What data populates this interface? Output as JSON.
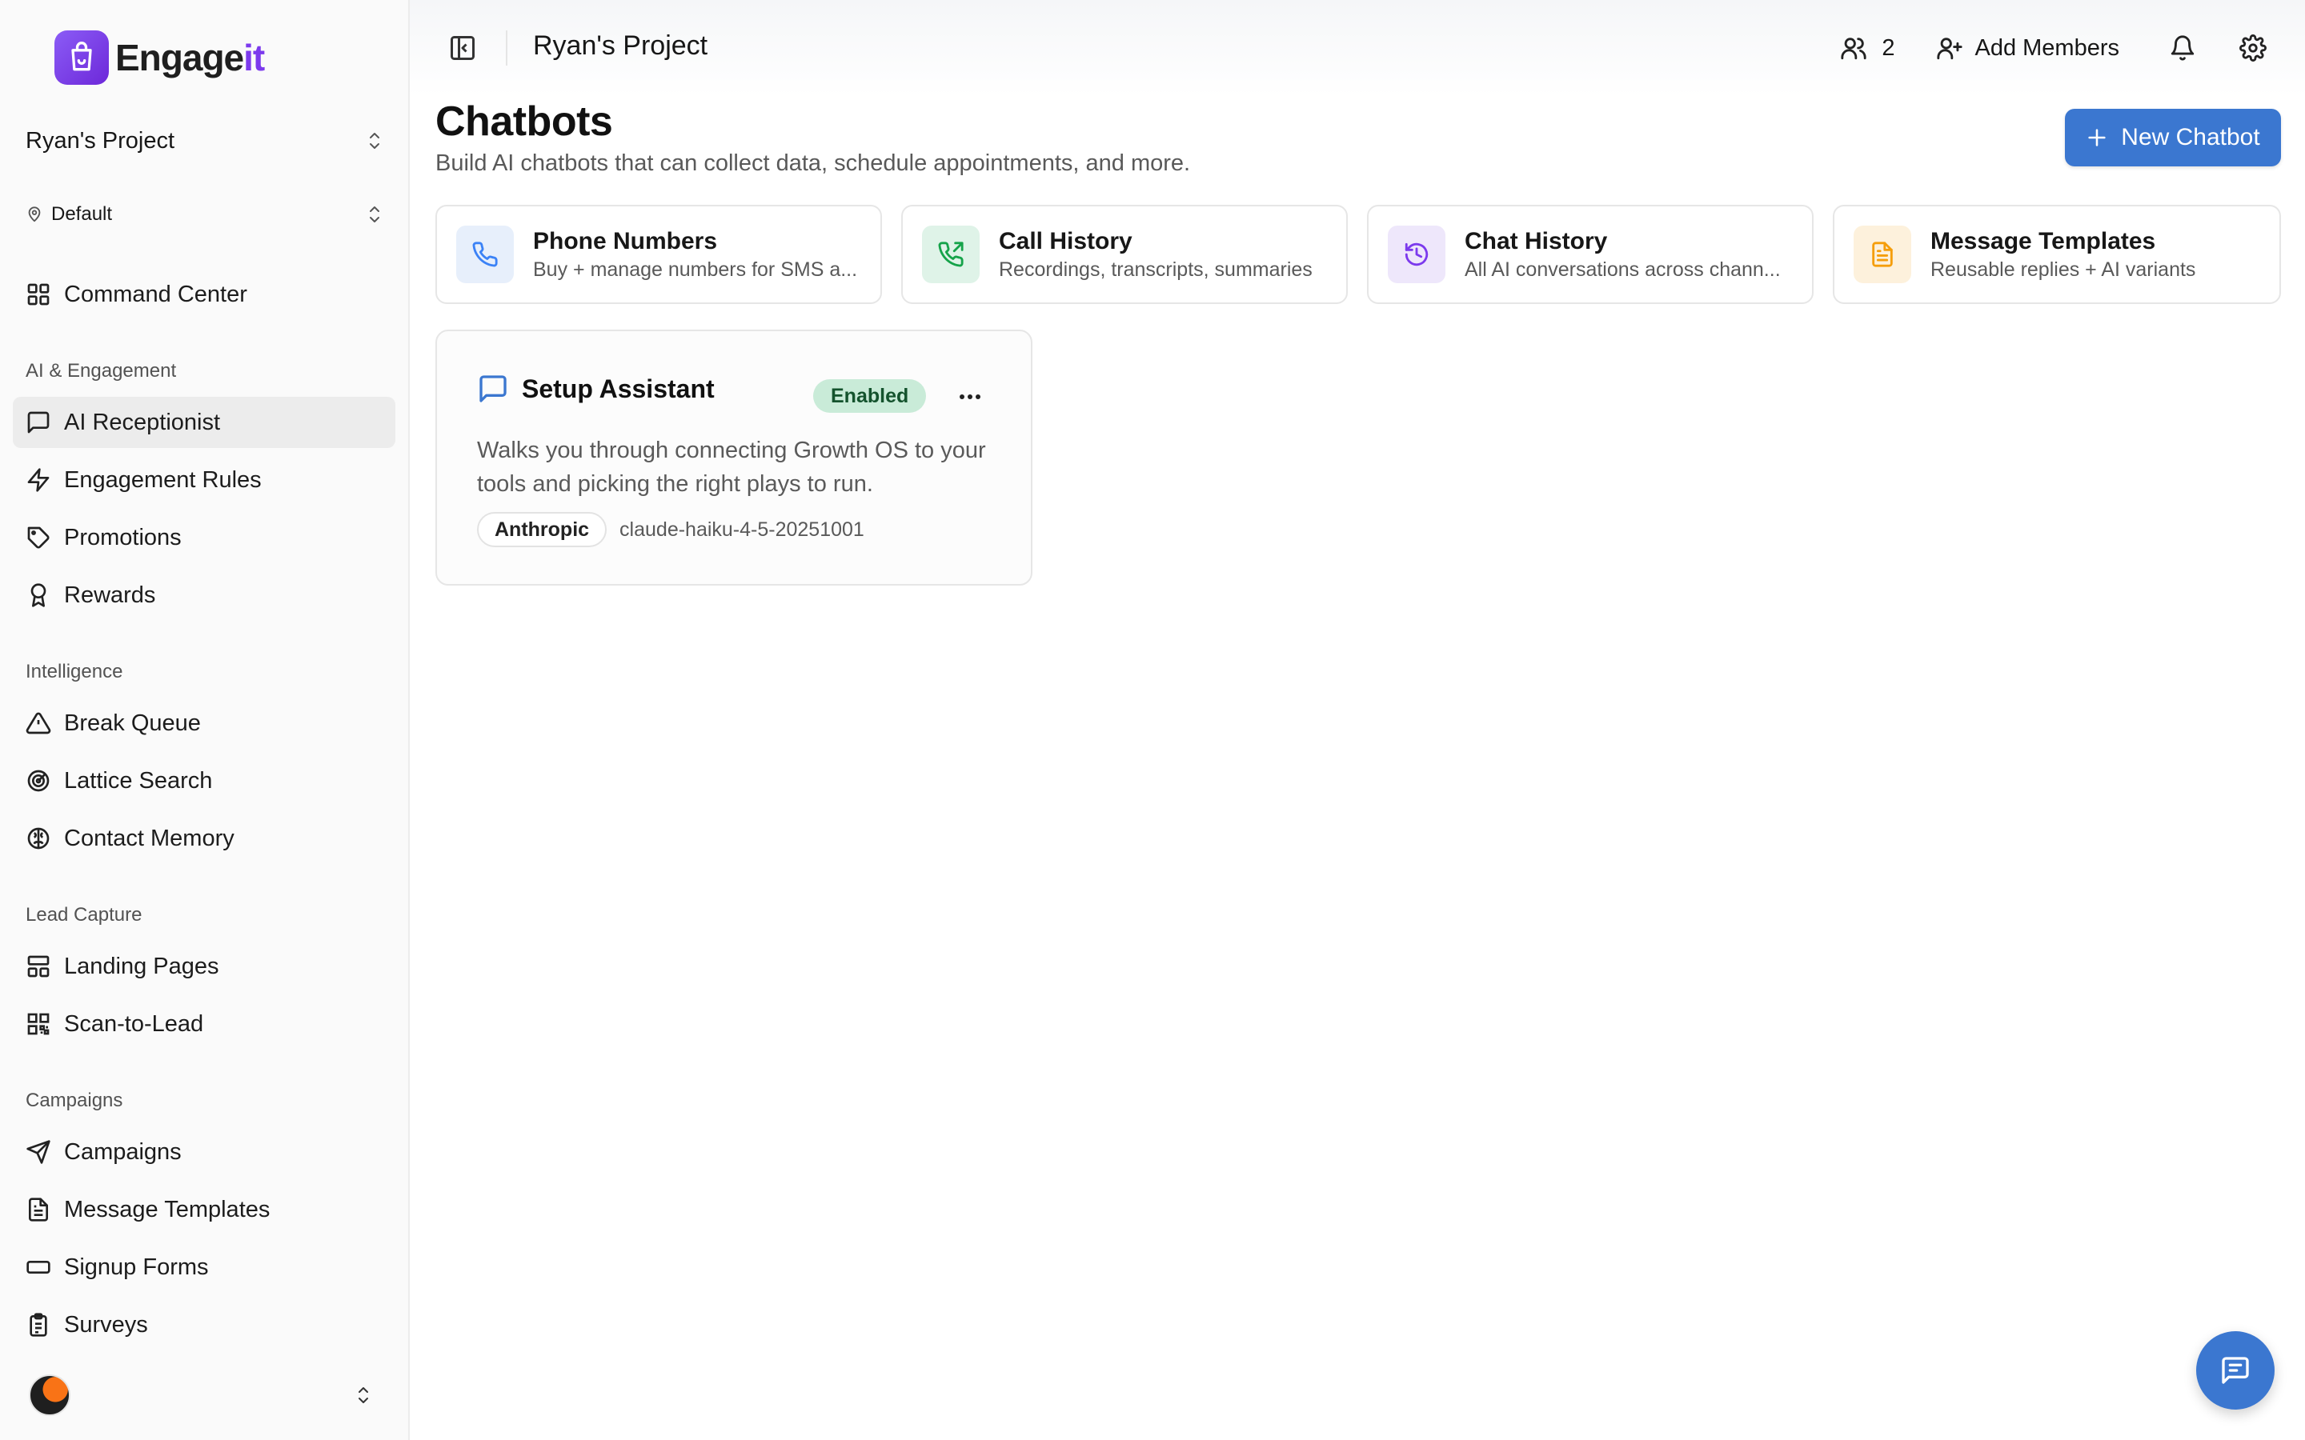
{
  "brand": {
    "name_main": "Engage",
    "name_accent": "it"
  },
  "sidebar": {
    "project_selector": "Ryan's Project",
    "environment_selector": "Default",
    "command_center": "Command Center",
    "sections": {
      "ai_engagement": "AI & Engagement",
      "intelligence": "Intelligence",
      "lead_capture": "Lead Capture",
      "campaigns": "Campaigns"
    },
    "items": {
      "ai_receptionist": "AI Receptionist",
      "engagement_rules": "Engagement Rules",
      "promotions": "Promotions",
      "rewards": "Rewards",
      "break_queue": "Break Queue",
      "lattice_search": "Lattice Search",
      "contact_memory": "Contact Memory",
      "landing_pages": "Landing Pages",
      "scan_to_lead": "Scan-to-Lead",
      "campaigns": "Campaigns",
      "message_templates": "Message Templates",
      "signup_forms": "Signup Forms",
      "surveys": "Surveys"
    },
    "active_item": "ai_receptionist"
  },
  "topbar": {
    "title": "Ryan's Project",
    "member_count": "2",
    "add_members": "Add Members"
  },
  "page": {
    "title": "Chatbots",
    "subtitle": "Build AI chatbots that can collect data, schedule appointments, and more.",
    "new_button": "New Chatbot"
  },
  "quick_cards": [
    {
      "title": "Phone Numbers",
      "desc": "Buy + manage numbers for SMS a...",
      "icon": "phone-icon",
      "color": "#3b82f6",
      "bg": "#e7effb"
    },
    {
      "title": "Call History",
      "desc": "Recordings, transcripts, summaries",
      "icon": "phone-outgoing-icon",
      "color": "#16a34a",
      "bg": "#dff3e8"
    },
    {
      "title": "Chat History",
      "desc": "All AI conversations across chann...",
      "icon": "history-icon",
      "color": "#7c3aed",
      "bg": "#eee7fb"
    },
    {
      "title": "Message Templates",
      "desc": "Reusable replies + AI variants",
      "icon": "document-icon",
      "color": "#f59e0b",
      "bg": "#fdf1dc"
    }
  ],
  "chatbots": [
    {
      "name": "Setup Assistant",
      "status": "Enabled",
      "description": "Walks you through connecting Growth OS to your tools and picking the right plays to run.",
      "provider": "Anthropic",
      "model": "claude-haiku-4-5-20251001"
    }
  ],
  "colors": {
    "primary": "#3b77d0",
    "brand_accent": "#7c3aed",
    "enabled_badge_bg": "#c9ebd8"
  }
}
